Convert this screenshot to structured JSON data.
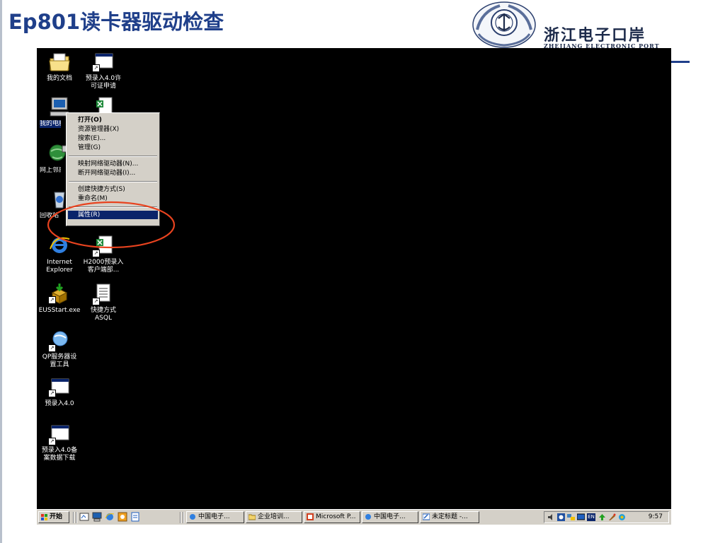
{
  "slide": {
    "title": "Ep801读卡器驱动检查",
    "logo_cn": "浙江电子口岸",
    "logo_en": "ZHEJIANG ELECTRONIC PORT"
  },
  "desktop_icons": [
    {
      "label": "我的文档"
    },
    {
      "label": "预录入4.0许\n可证申请"
    },
    {
      "label": "我的电脑"
    },
    {
      "label": "网上邻居"
    },
    {
      "label": "回收站"
    },
    {
      "label": "Internet\nExplorer"
    },
    {
      "label": "H2000预录入\n客户端部..."
    },
    {
      "label": "EUSStart.exe"
    },
    {
      "label": "快捷方式\nASQL"
    },
    {
      "label": "QP服务器设\n置工具"
    },
    {
      "label": "预录入4.0"
    },
    {
      "label": "预录入4.0备\n案数据下载"
    }
  ],
  "context_menu": {
    "items": [
      {
        "label": "打开(O)"
      },
      {
        "label": "资源管理器(X)"
      },
      {
        "label": "搜索(E)..."
      },
      {
        "label": "管理(G)"
      },
      {
        "label": "映射网络驱动器(N)..."
      },
      {
        "label": "断开网络驱动器(I)..."
      },
      {
        "label": "创建快捷方式(S)"
      },
      {
        "label": "重命名(M)"
      },
      {
        "label": "属性(R)"
      }
    ]
  },
  "taskbar": {
    "start_label": "开始",
    "buttons": [
      {
        "label": "中国电子..."
      },
      {
        "label": "企业培训..."
      },
      {
        "label": "Microsoft P..."
      },
      {
        "label": "中国电子..."
      },
      {
        "label": "未定标题 -..."
      }
    ],
    "tray_lang": "EN",
    "clock": "9:57"
  },
  "colors": {
    "title": "#1f3f8a",
    "desktop": "#000000",
    "highlight": "#0a246a",
    "annotation": "#e8431f"
  }
}
